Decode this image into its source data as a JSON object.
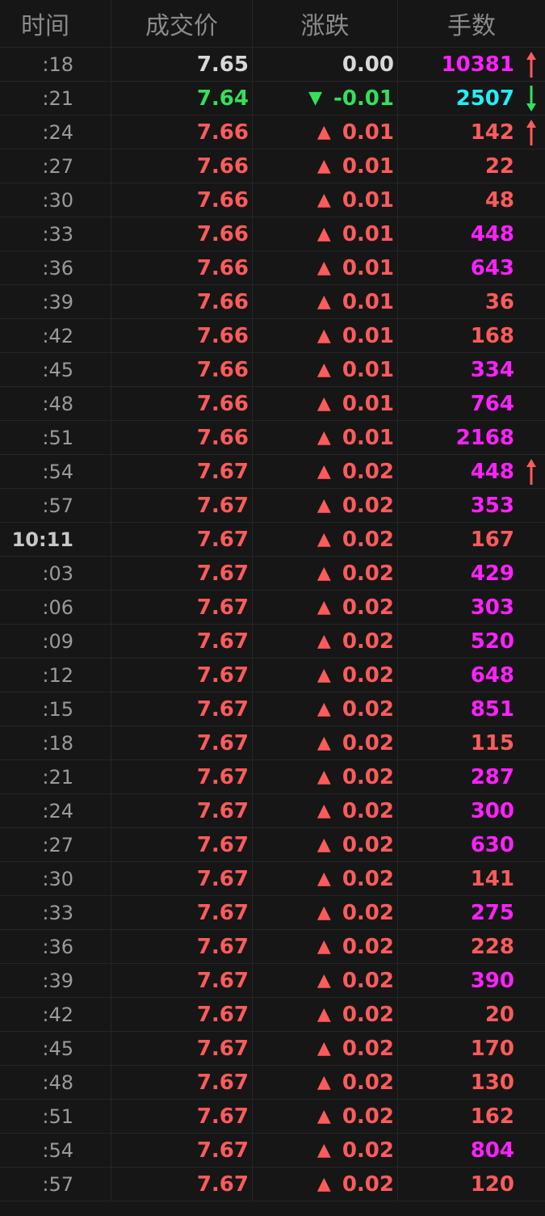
{
  "colors": {
    "up": "#ff5b5b",
    "down": "#33e05a",
    "flat": "#d8d8d8",
    "big_volume": "#ff22ff",
    "sell_volume": "#22f0f6"
  },
  "header": {
    "time": "时间",
    "price": "成交价",
    "change": "涨跌",
    "volume": "手数"
  },
  "rows": [
    {
      "time": ":18",
      "price": "7.65",
      "change": "0.00",
      "volume": "10381",
      "trend": "flat",
      "vol_color": "big_volume",
      "arrow": "up",
      "arrow_icon": "red-up-arrow-icon"
    },
    {
      "time": ":21",
      "price": "7.64",
      "change": "-0.01",
      "volume": "2507",
      "trend": "down",
      "vol_color": "sell_volume",
      "arrow": "down",
      "arrow_icon": "green-down-arrow-icon"
    },
    {
      "time": ":24",
      "price": "7.66",
      "change": "0.01",
      "volume": "142",
      "trend": "up",
      "vol_color": "up",
      "arrow": "up",
      "arrow_icon": "red-up-arrow-icon"
    },
    {
      "time": ":27",
      "price": "7.66",
      "change": "0.01",
      "volume": "22",
      "trend": "up",
      "vol_color": "up"
    },
    {
      "time": ":30",
      "price": "7.66",
      "change": "0.01",
      "volume": "48",
      "trend": "up",
      "vol_color": "up"
    },
    {
      "time": ":33",
      "price": "7.66",
      "change": "0.01",
      "volume": "448",
      "trend": "up",
      "vol_color": "big_volume"
    },
    {
      "time": ":36",
      "price": "7.66",
      "change": "0.01",
      "volume": "643",
      "trend": "up",
      "vol_color": "big_volume"
    },
    {
      "time": ":39",
      "price": "7.66",
      "change": "0.01",
      "volume": "36",
      "trend": "up",
      "vol_color": "up"
    },
    {
      "time": ":42",
      "price": "7.66",
      "change": "0.01",
      "volume": "168",
      "trend": "up",
      "vol_color": "up"
    },
    {
      "time": ":45",
      "price": "7.66",
      "change": "0.01",
      "volume": "334",
      "trend": "up",
      "vol_color": "big_volume"
    },
    {
      "time": ":48",
      "price": "7.66",
      "change": "0.01",
      "volume": "764",
      "trend": "up",
      "vol_color": "big_volume"
    },
    {
      "time": ":51",
      "price": "7.66",
      "change": "0.01",
      "volume": "2168",
      "trend": "up",
      "vol_color": "big_volume"
    },
    {
      "time": ":54",
      "price": "7.67",
      "change": "0.02",
      "volume": "448",
      "trend": "up",
      "vol_color": "big_volume",
      "arrow": "up",
      "arrow_icon": "red-up-arrow-icon"
    },
    {
      "time": ":57",
      "price": "7.67",
      "change": "0.02",
      "volume": "353",
      "trend": "up",
      "vol_color": "big_volume"
    },
    {
      "time": "10:11",
      "price": "7.67",
      "change": "0.02",
      "volume": "167",
      "trend": "up",
      "vol_color": "up",
      "hour": true
    },
    {
      "time": ":03",
      "price": "7.67",
      "change": "0.02",
      "volume": "429",
      "trend": "up",
      "vol_color": "big_volume"
    },
    {
      "time": ":06",
      "price": "7.67",
      "change": "0.02",
      "volume": "303",
      "trend": "up",
      "vol_color": "big_volume"
    },
    {
      "time": ":09",
      "price": "7.67",
      "change": "0.02",
      "volume": "520",
      "trend": "up",
      "vol_color": "big_volume"
    },
    {
      "time": ":12",
      "price": "7.67",
      "change": "0.02",
      "volume": "648",
      "trend": "up",
      "vol_color": "big_volume"
    },
    {
      "time": ":15",
      "price": "7.67",
      "change": "0.02",
      "volume": "851",
      "trend": "up",
      "vol_color": "big_volume"
    },
    {
      "time": ":18",
      "price": "7.67",
      "change": "0.02",
      "volume": "115",
      "trend": "up",
      "vol_color": "up"
    },
    {
      "time": ":21",
      "price": "7.67",
      "change": "0.02",
      "volume": "287",
      "trend": "up",
      "vol_color": "big_volume"
    },
    {
      "time": ":24",
      "price": "7.67",
      "change": "0.02",
      "volume": "300",
      "trend": "up",
      "vol_color": "big_volume"
    },
    {
      "time": ":27",
      "price": "7.67",
      "change": "0.02",
      "volume": "630",
      "trend": "up",
      "vol_color": "big_volume"
    },
    {
      "time": ":30",
      "price": "7.67",
      "change": "0.02",
      "volume": "141",
      "trend": "up",
      "vol_color": "up"
    },
    {
      "time": ":33",
      "price": "7.67",
      "change": "0.02",
      "volume": "275",
      "trend": "up",
      "vol_color": "big_volume"
    },
    {
      "time": ":36",
      "price": "7.67",
      "change": "0.02",
      "volume": "228",
      "trend": "up",
      "vol_color": "up"
    },
    {
      "time": ":39",
      "price": "7.67",
      "change": "0.02",
      "volume": "390",
      "trend": "up",
      "vol_color": "big_volume"
    },
    {
      "time": ":42",
      "price": "7.67",
      "change": "0.02",
      "volume": "20",
      "trend": "up",
      "vol_color": "up"
    },
    {
      "time": ":45",
      "price": "7.67",
      "change": "0.02",
      "volume": "170",
      "trend": "up",
      "vol_color": "up"
    },
    {
      "time": ":48",
      "price": "7.67",
      "change": "0.02",
      "volume": "130",
      "trend": "up",
      "vol_color": "up"
    },
    {
      "time": ":51",
      "price": "7.67",
      "change": "0.02",
      "volume": "162",
      "trend": "up",
      "vol_color": "up"
    },
    {
      "time": ":54",
      "price": "7.67",
      "change": "0.02",
      "volume": "804",
      "trend": "up",
      "vol_color": "big_volume"
    },
    {
      "time": ":57",
      "price": "7.67",
      "change": "0.02",
      "volume": "120",
      "trend": "up",
      "vol_color": "up"
    }
  ]
}
